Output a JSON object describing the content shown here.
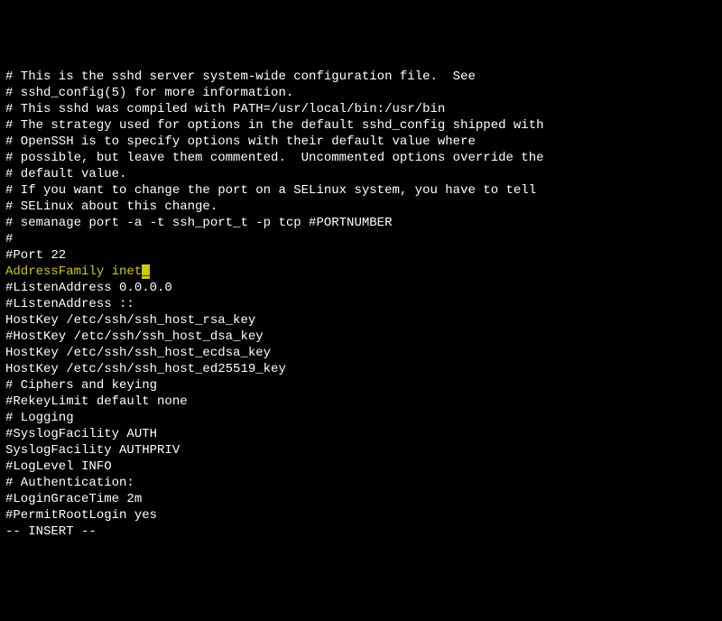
{
  "lines": [
    "# This is the sshd server system-wide configuration file.  See",
    "# sshd_config(5) for more information.",
    "",
    "# This sshd was compiled with PATH=/usr/local/bin:/usr/bin",
    "",
    "# The strategy used for options in the default sshd_config shipped with",
    "# OpenSSH is to specify options with their default value where",
    "# possible, but leave them commented.  Uncommented options override the",
    "# default value.",
    "",
    "# If you want to change the port on a SELinux system, you have to tell",
    "# SELinux about this change.",
    "# semanage port -a -t ssh_port_t -p tcp #PORTNUMBER",
    "#",
    "#Port 22"
  ],
  "highlighted_line": "AddressFamily inet",
  "cursor_char": "_",
  "lines_after": [
    "#ListenAddress 0.0.0.0",
    "#ListenAddress ::",
    "",
    "HostKey /etc/ssh/ssh_host_rsa_key",
    "#HostKey /etc/ssh/ssh_host_dsa_key",
    "HostKey /etc/ssh/ssh_host_ecdsa_key",
    "HostKey /etc/ssh/ssh_host_ed25519_key",
    "",
    "# Ciphers and keying",
    "#RekeyLimit default none",
    "",
    "# Logging",
    "#SyslogFacility AUTH",
    "SyslogFacility AUTHPRIV",
    "#LogLevel INFO",
    "",
    "# Authentication:",
    "",
    "#LoginGraceTime 2m",
    "#PermitRootLogin yes"
  ],
  "status_line": "-- INSERT --"
}
